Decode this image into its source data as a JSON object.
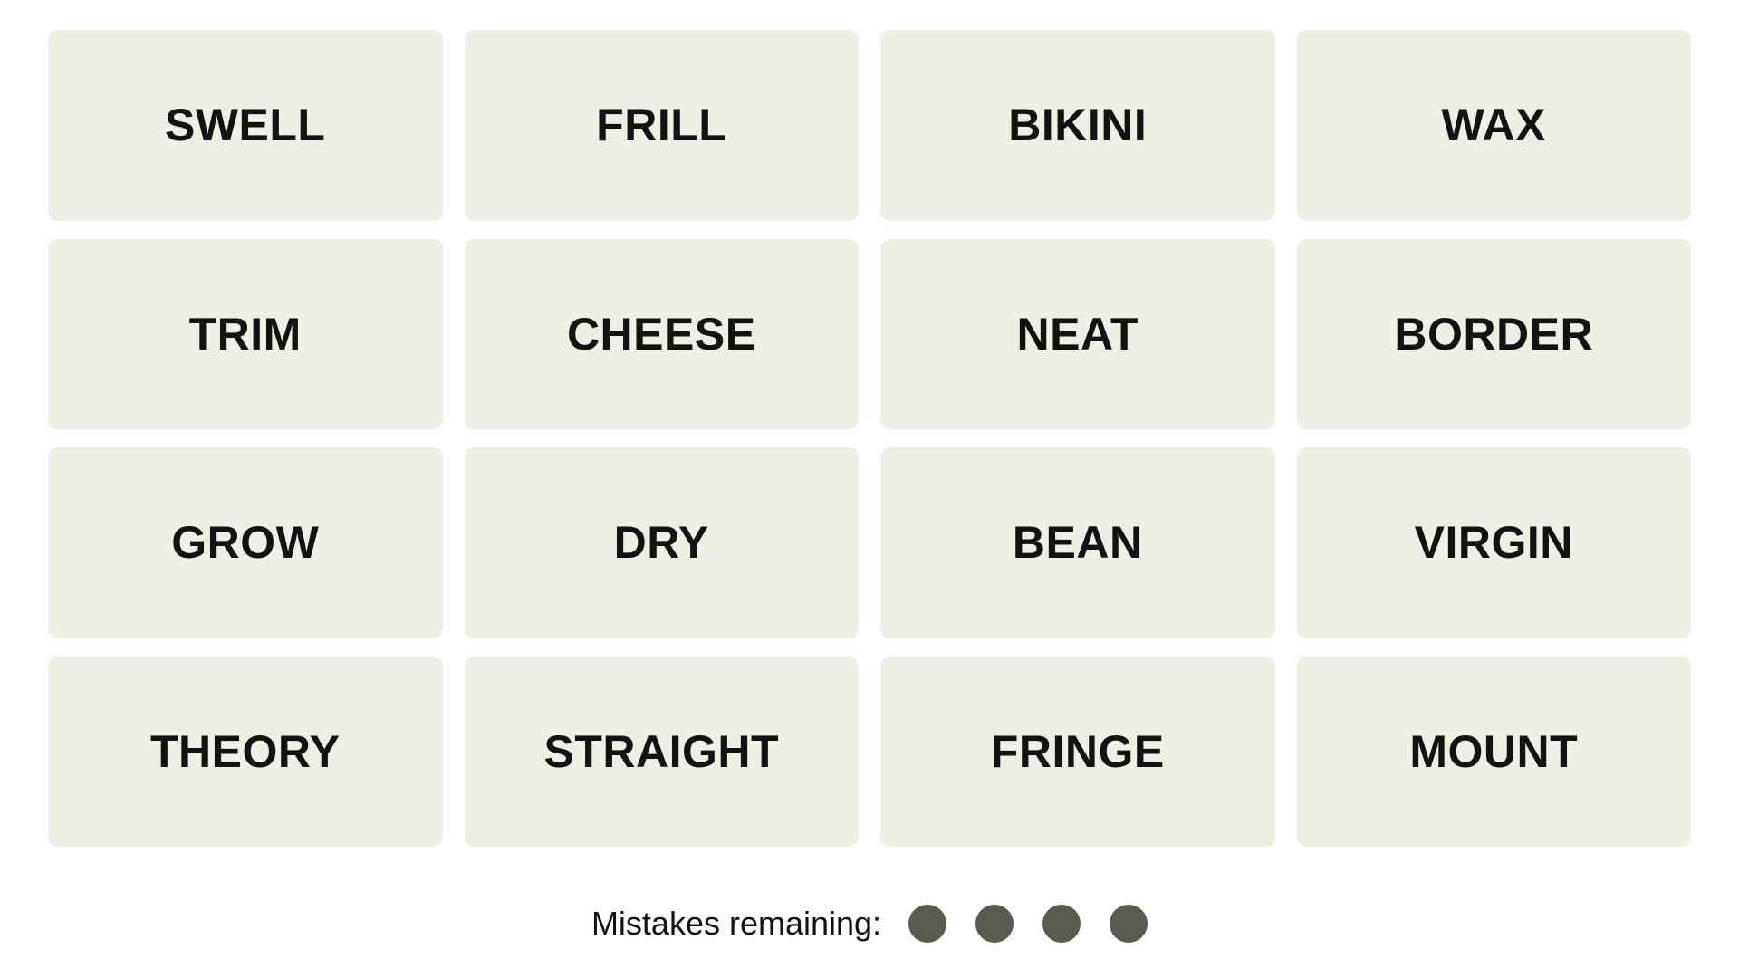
{
  "game": {
    "name": "Connections",
    "background_color": "#ffffff"
  },
  "board": {
    "tile_color": "#EFEFE6",
    "tile_text_color": "#121212",
    "rows": [
      [
        "SWELL",
        "FRILL",
        "BIKINI",
        "WAX"
      ],
      [
        "TRIM",
        "CHEESE",
        "NEAT",
        "BORDER"
      ],
      [
        "GROW",
        "DRY",
        "BEAN",
        "VIRGIN"
      ],
      [
        "THEORY",
        "STRAIGHT",
        "FRINGE",
        "MOUNT"
      ]
    ],
    "tiles": [
      "SWELL",
      "FRILL",
      "BIKINI",
      "WAX",
      "TRIM",
      "CHEESE",
      "NEAT",
      "BORDER",
      "GROW",
      "DRY",
      "BEAN",
      "VIRGIN",
      "THEORY",
      "STRAIGHT",
      "FRINGE",
      "MOUNT"
    ],
    "selected": []
  },
  "footer": {
    "mistakes_label": "Mistakes remaining:",
    "mistakes_remaining": 4,
    "dot_color": "#5A5A50",
    "dots": [
      "mistake-dot",
      "mistake-dot",
      "mistake-dot",
      "mistake-dot"
    ]
  }
}
